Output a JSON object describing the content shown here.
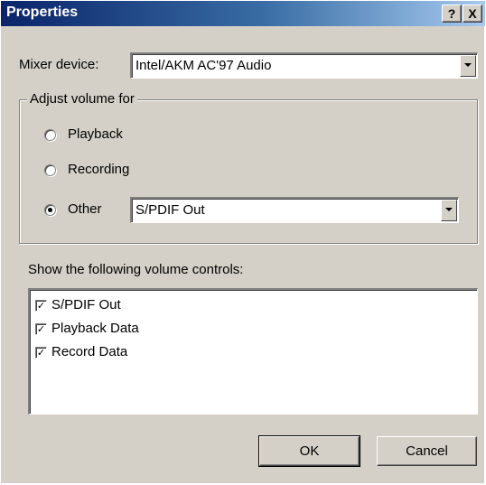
{
  "window": {
    "title": "Properties",
    "help_label": "?",
    "close_label": "X"
  },
  "mixer": {
    "label": "Mixer device:",
    "value": "Intel/AKM AC'97 Audio"
  },
  "adjust": {
    "legend": "Adjust volume for",
    "options": [
      {
        "label": "Playback",
        "checked": false
      },
      {
        "label": "Recording",
        "checked": false
      },
      {
        "label": "Other",
        "checked": true
      }
    ],
    "other_value": "S/PDIF Out"
  },
  "controls": {
    "label": "Show the following volume controls:",
    "items": [
      {
        "label": "S/PDIF Out",
        "checked": true,
        "mark": "✓"
      },
      {
        "label": "Playback Data",
        "checked": true,
        "mark": "✓"
      },
      {
        "label": "Record Data",
        "checked": true,
        "mark": "✓"
      }
    ]
  },
  "buttons": {
    "ok": "OK",
    "cancel": "Cancel"
  },
  "colors": {
    "title_start": "#0a246a",
    "title_end": "#a6caf0",
    "dialog_bg": "#d4d0c8"
  }
}
